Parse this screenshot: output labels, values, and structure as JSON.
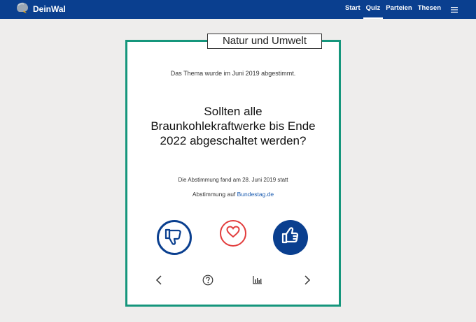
{
  "brand": {
    "name": "DeinWal",
    "logo_icon": "whale-logo-icon"
  },
  "nav": {
    "items": [
      {
        "label": "Start"
      },
      {
        "label": "Quiz",
        "active": true
      },
      {
        "label": "Parteien"
      },
      {
        "label": "Thesen"
      }
    ],
    "menu_icon": "hamburger-menu-icon"
  },
  "card": {
    "category": "Natur und Umwelt",
    "date_note": "Das Thema wurde im Juni 2019 abgestimmt.",
    "question": "Sollten alle Braunkohlekraftwerke bis Ende 2022 abgeschaltet werden?",
    "vote_date": "Die Abstimmung fand am 28. Juni 2019 statt",
    "vote_link_prefix": "Abstimmung auf",
    "vote_link_text": "Bundestag.de"
  },
  "buttons": {
    "no_icon": "thumbs-down-icon",
    "favorite_icon": "heart-icon",
    "yes_icon": "thumbs-up-icon"
  },
  "controls": {
    "prev_icon": "chevron-left-icon",
    "help_icon": "question-circle-icon",
    "stats_icon": "bar-chart-icon",
    "next_icon": "chevron-right-icon"
  },
  "colors": {
    "navbar": "#0a3f8f",
    "card_border": "#15967c",
    "heart": "#e23c3c",
    "link": "#1a5bb0",
    "background": "#eeedec"
  }
}
